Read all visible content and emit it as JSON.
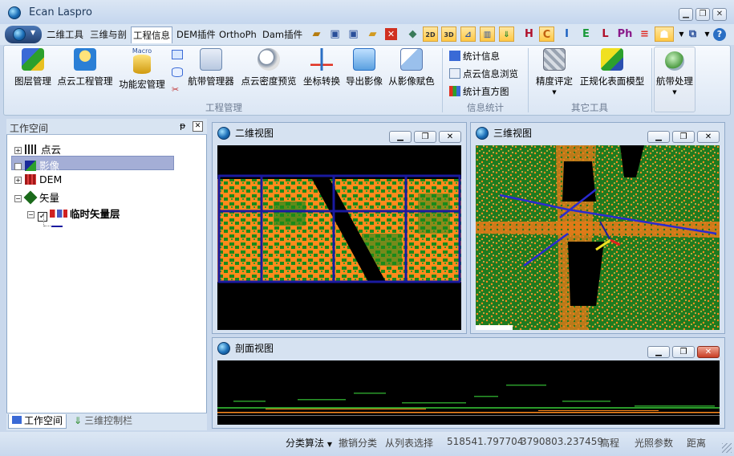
{
  "app": {
    "title": "Ecan Laspro"
  },
  "menu_tabs": [
    "二维工具",
    "三维与剖",
    "工程信息",
    "DEM插件",
    "OrthoPh",
    "Dam插件"
  ],
  "quick_letters": [
    "H",
    "C",
    "I",
    "E",
    "L",
    "Ph"
  ],
  "ribbon": {
    "engineering": {
      "group_label": "工程管理",
      "buttons": [
        "图层管理",
        "点云工程管理",
        "功能宏管理",
        "航带管理器",
        "点云密度预览",
        "坐标转换",
        "导出影像",
        "从影像赋色"
      ]
    },
    "info": {
      "group_label": "信息统计",
      "items": [
        "统计信息",
        "点云信息浏览",
        "统计直方图"
      ]
    },
    "other": {
      "group_label": "其它工具",
      "buttons": [
        "精度评定",
        "正规化表面模型"
      ]
    },
    "strip": {
      "button": "航带处理"
    },
    "macro_caption": "Macro"
  },
  "workspace": {
    "title": "工作空间",
    "pin": "ᵽ",
    "items": [
      "点云",
      "影像",
      "DEM",
      "矢量",
      "临时矢量层"
    ],
    "tabs": [
      "工作空间",
      "三维控制栏"
    ]
  },
  "views": {
    "view2d": {
      "title": "二维视图"
    },
    "view3d": {
      "title": "三维视图"
    },
    "profile": {
      "title": "剖面视图"
    }
  },
  "status": {
    "classify": "分类算法",
    "undo": "撤销分类",
    "select_from_list": "从列表选择",
    "x": "518541.797704",
    "y": "3790803.237459",
    "elevation": "高程",
    "lighting": "光照参数",
    "distance": "距离"
  },
  "colors": {
    "ground": "#ff8a1c",
    "vegetation": "#1a8a1a",
    "grid": "#1a1aa0",
    "ribbon_highlight": "#ffc845"
  }
}
